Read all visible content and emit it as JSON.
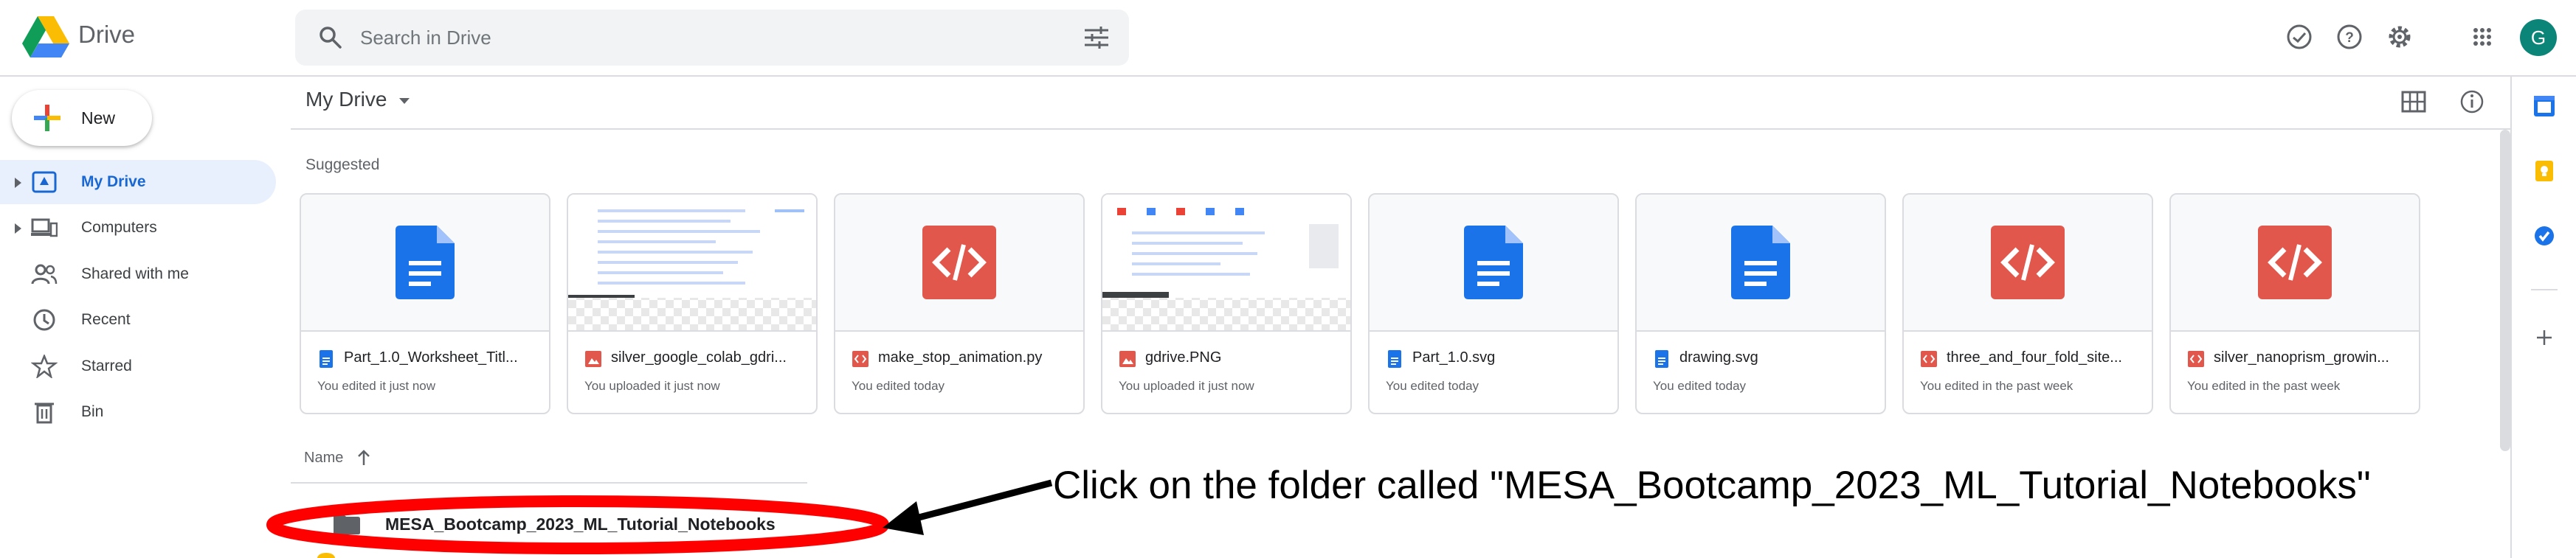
{
  "app": {
    "brand": "Drive"
  },
  "search": {
    "placeholder": "Search in Drive",
    "icon": "search-icon",
    "tune_icon": "tune-icon"
  },
  "header_icons": [
    "offline-status-icon",
    "help-icon",
    "settings-icon",
    "apps-grid-icon"
  ],
  "account": {
    "initial": "G",
    "color": "#0b8577"
  },
  "new_button": {
    "label": "New"
  },
  "nav": {
    "items": [
      {
        "label": "My Drive",
        "icon": "my-drive-icon",
        "active": true,
        "expandable": true
      },
      {
        "label": "Computers",
        "icon": "computers-icon",
        "active": false,
        "expandable": true
      },
      {
        "label": "Shared with me",
        "icon": "shared-icon",
        "active": false,
        "expandable": false
      },
      {
        "label": "Recent",
        "icon": "clock-icon",
        "active": false,
        "expandable": false
      },
      {
        "label": "Starred",
        "icon": "star-icon",
        "active": false,
        "expandable": false
      },
      {
        "label": "Bin",
        "icon": "bin-icon",
        "active": false,
        "expandable": false
      }
    ]
  },
  "main": {
    "title": "My Drive",
    "suggested_label": "Suggested",
    "view_icons": [
      "grid-view-icon",
      "info-icon"
    ],
    "cards": [
      {
        "name": "Part_1.0_Worksheet_Titl...",
        "meta": "You edited it just now",
        "type": "doc"
      },
      {
        "name": "silver_google_colab_gdri...",
        "meta": "You uploaded it just now",
        "type": "image"
      },
      {
        "name": "make_stop_animation.py",
        "meta": "You edited today",
        "type": "code"
      },
      {
        "name": "gdrive.PNG",
        "meta": "You uploaded it just now",
        "type": "image"
      },
      {
        "name": "Part_1.0.svg",
        "meta": "You edited today",
        "type": "doc"
      },
      {
        "name": "drawing.svg",
        "meta": "You edited today",
        "type": "doc"
      },
      {
        "name": "three_and_four_fold_site...",
        "meta": "You edited in the past week",
        "type": "code"
      },
      {
        "name": "silver_nanoprism_growin...",
        "meta": "You edited in the past week",
        "type": "code"
      }
    ],
    "list": {
      "sort_header": "Name",
      "folder": "MESA_Bootcamp_2023_ML_Tutorial_Notebooks"
    }
  },
  "annotation": {
    "text": "Click on the folder called \"MESA_Bootcamp_2023_ML_Tutorial_Notebooks\"",
    "ring_color": "#ff0000"
  },
  "colors": {
    "accent": "#1967d2",
    "doc_blue": "#1a73e8",
    "code_red": "#e2574c",
    "active_bg": "#e8f0fe"
  }
}
